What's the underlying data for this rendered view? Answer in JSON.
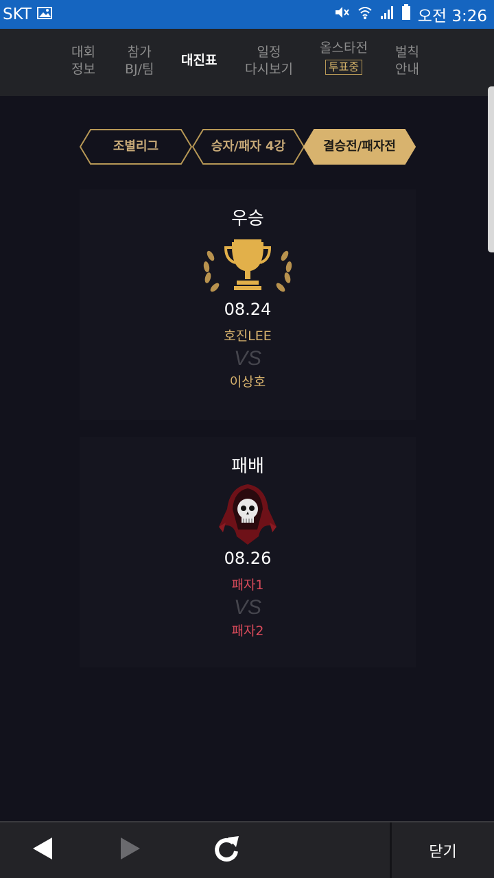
{
  "status_bar": {
    "carrier": "SKT",
    "time": "오전 3:26",
    "icons": [
      "gallery-icon",
      "mute-icon",
      "wifi-icon",
      "signal-icon",
      "battery-icon"
    ]
  },
  "nav": {
    "items": [
      {
        "line1": "대회",
        "line2": "정보"
      },
      {
        "line1": "참가",
        "line2": "BJ/팀"
      },
      {
        "line1": "대진표"
      },
      {
        "line1": "일정",
        "line2": "다시보기"
      },
      {
        "line1": "올스타전",
        "badge": "투표중"
      },
      {
        "line1": "벌칙",
        "line2": "안내"
      }
    ]
  },
  "stage_tabs": [
    "조별리그",
    "승자/패자 4강",
    "결승전/패자전"
  ],
  "cards": [
    {
      "title": "우승",
      "date": "08.24",
      "player1": "호진LEE",
      "vs": "VS",
      "player2": "이상호",
      "icon": "trophy-icon"
    },
    {
      "title": "패배",
      "date": "08.26",
      "player1": "패자1",
      "vs": "VS",
      "player2": "패자2",
      "icon": "skull-reaper-icon"
    }
  ],
  "bottom_bar": {
    "close_label": "닫기",
    "icons": [
      "back-icon",
      "forward-icon",
      "refresh-icon"
    ]
  },
  "colors": {
    "status_bar": "#1565c0",
    "gold": "#d8b36e",
    "loser_red": "#d84a5a",
    "background": "#12121c"
  }
}
